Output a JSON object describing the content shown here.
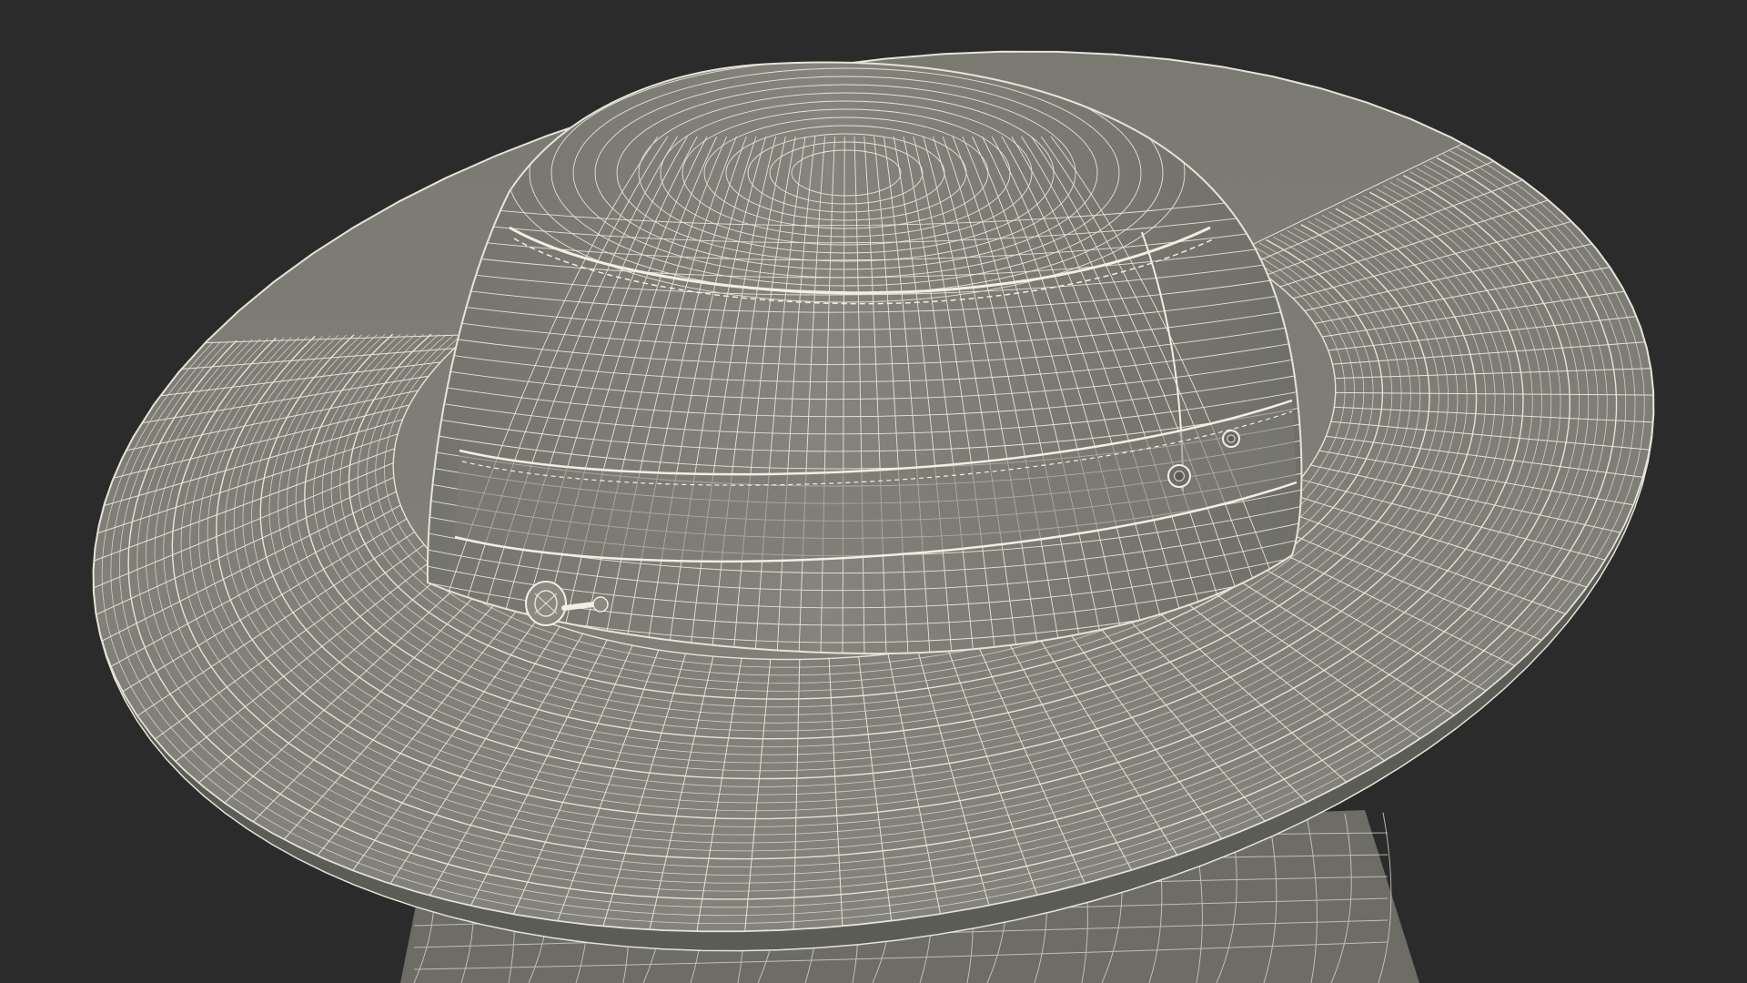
{
  "scene": {
    "subject": "wire-frame-hat",
    "colors": {
      "background": "#2b2b2b",
      "surface": "#7c7c74",
      "surface_shade": "#6d6d66",
      "surface_light": "#8a8a82",
      "wire": "#e6e4d8",
      "wire_dim": "#cfcdc2",
      "seam": "#f1efe4",
      "shadow": "#5c5c56"
    },
    "parts": [
      "brim",
      "crown",
      "band",
      "neck-flap",
      "toggle",
      "grommet"
    ]
  }
}
